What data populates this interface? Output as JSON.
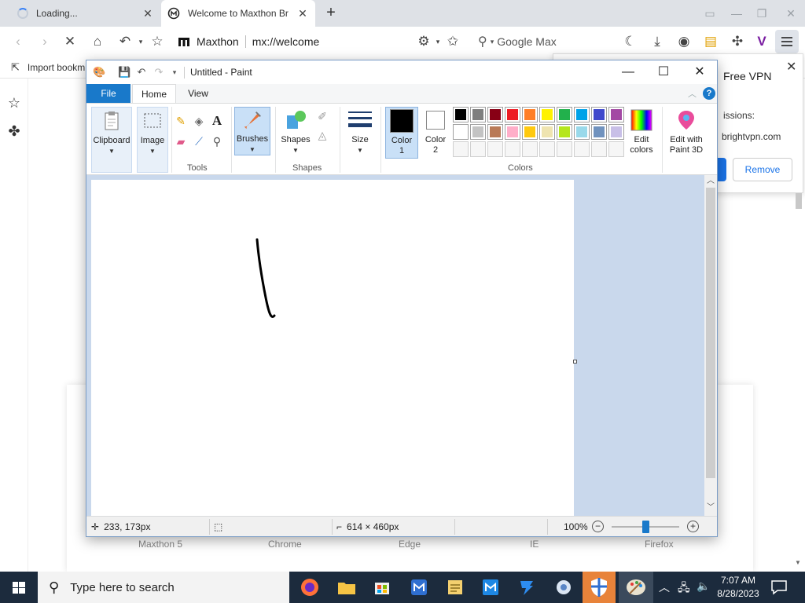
{
  "browser": {
    "tabs": [
      {
        "label": "Loading..."
      },
      {
        "label": "Welcome to Maxthon Br"
      }
    ],
    "address": {
      "brand": "Maxthon",
      "url": "mx://welcome"
    },
    "search_placeholder": "Google Max",
    "bookmark_label": "Import bookm",
    "browser_labels": [
      "Maxthon 5",
      "Chrome",
      "Edge",
      "IE",
      "Firefox"
    ]
  },
  "vpn_popup": {
    "title": "Free VPN",
    "permissions": "issions:",
    "host": "brightvpn.com",
    "remove_label": "Remove"
  },
  "paint": {
    "title": "Untitled - Paint",
    "file_tab": "File",
    "tabs": [
      "Home",
      "View"
    ],
    "help": "?",
    "ribbon": {
      "clipboard": "Clipboard",
      "image": "Image",
      "tools_label": "Tools",
      "brushes": "Brushes",
      "shapes": "Shapes",
      "shapes_label": "Shapes",
      "size": "Size",
      "color1": "Color\n1",
      "color1_a": "Color",
      "color1_b": "1",
      "color2_a": "Color",
      "color2_b": "2",
      "colors_label": "Colors",
      "edit_colors_a": "Edit",
      "edit_colors_b": "colors",
      "paint3d_a": "Edit with",
      "paint3d_b": "Paint 3D"
    },
    "palette_row1": [
      "#000000",
      "#7f7f7f",
      "#880015",
      "#ed1c24",
      "#ff7f27",
      "#fff200",
      "#22b14c",
      "#00a2e8",
      "#3f48cc",
      "#a349a4"
    ],
    "palette_row2": [
      "#ffffff",
      "#c3c3c3",
      "#b97a57",
      "#ffaec9",
      "#ffc90e",
      "#efe4b0",
      "#b5e61d",
      "#99d9ea",
      "#7092be",
      "#c8bfe7"
    ],
    "status": {
      "cursor": "233, 173px",
      "canvas_size": "614 × 460px",
      "zoom": "100%"
    }
  },
  "taskbar": {
    "search_placeholder": "Type here to search",
    "time": "7:07 AM",
    "date": "8/28/2023"
  },
  "colors": {
    "paint_accent": "#1979ca",
    "taskbar_bg": "#1c2b3d"
  }
}
